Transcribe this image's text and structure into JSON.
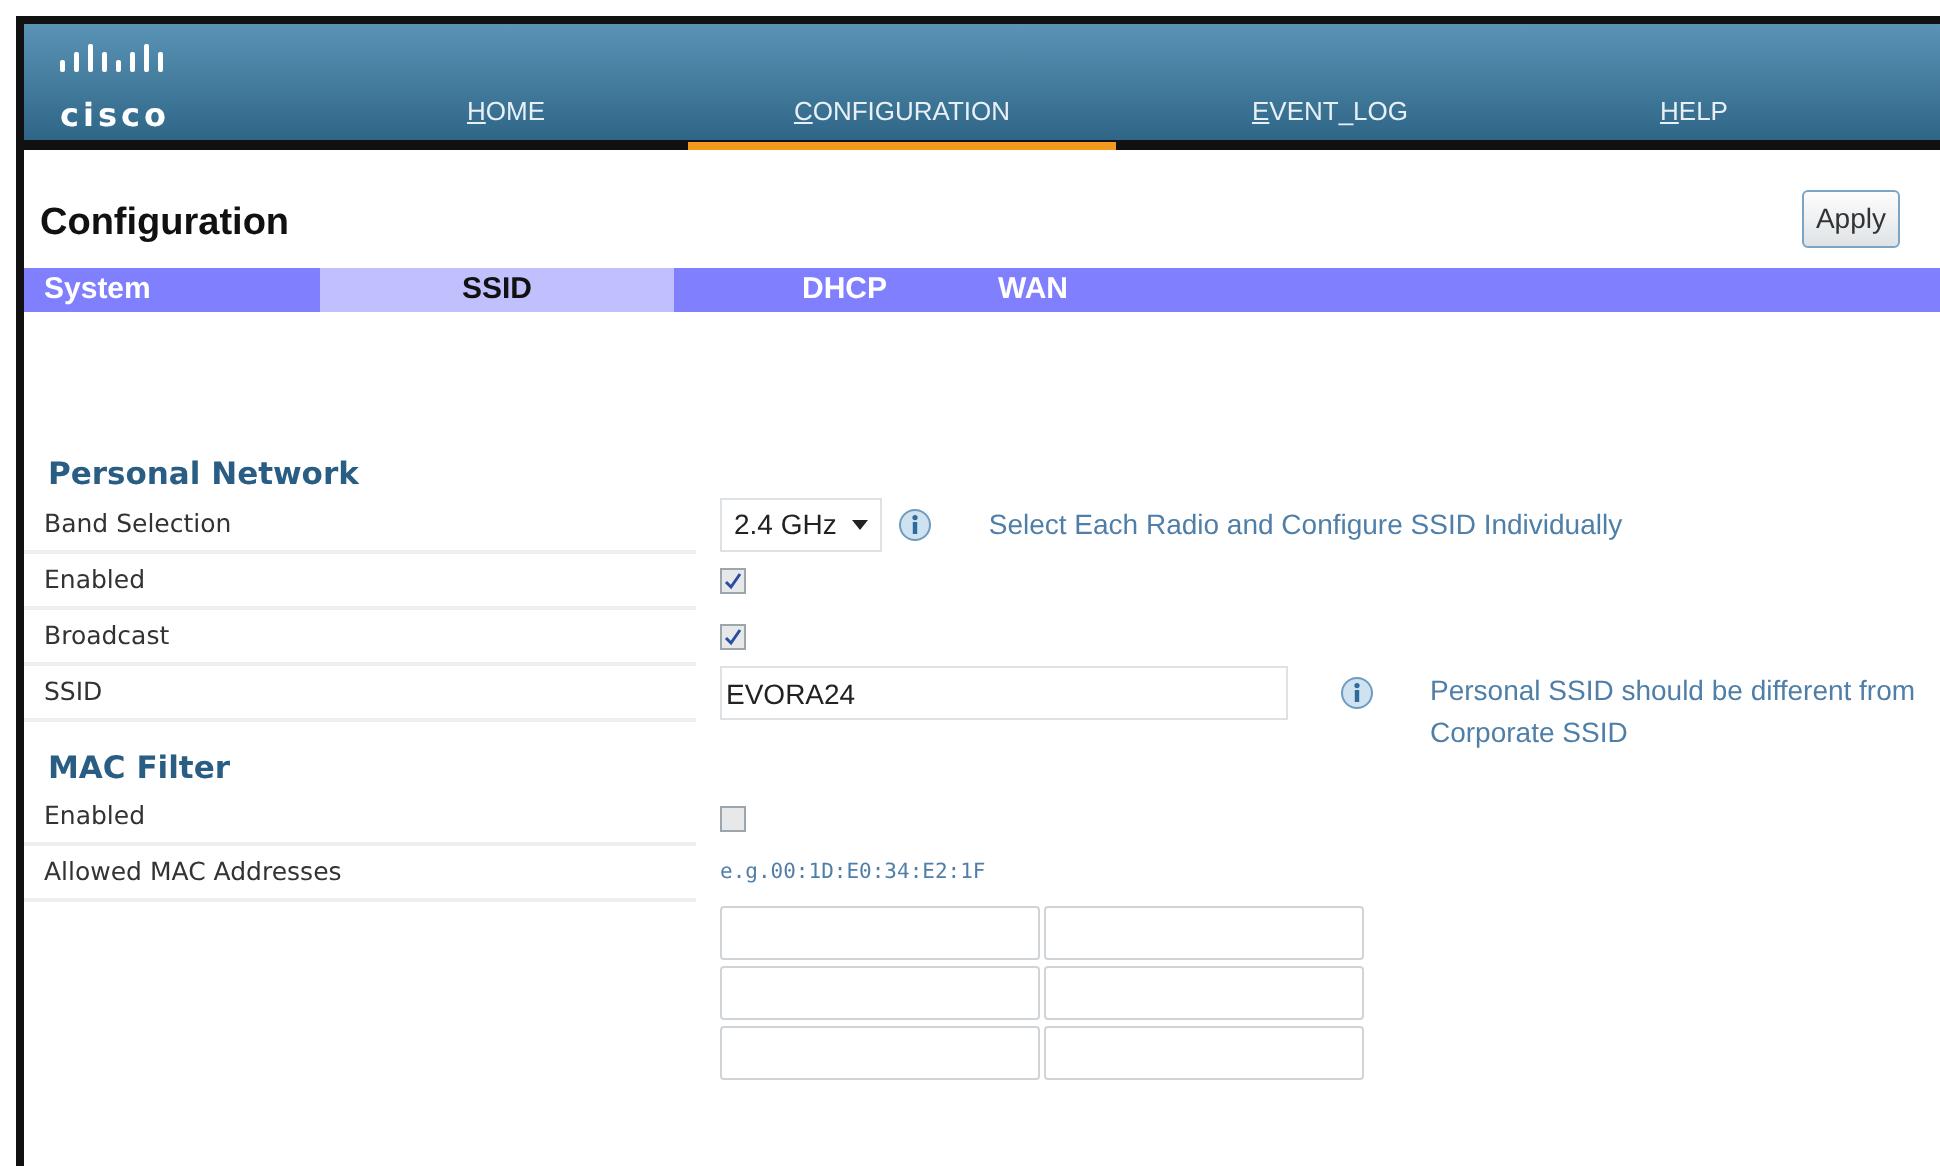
{
  "header": {
    "logo": "cisco"
  },
  "nav": [
    {
      "label": "HOME",
      "selected": false
    },
    {
      "label": "CONFIGURATION",
      "selected": true
    },
    {
      "label": "EVENT_LOG",
      "selected": false
    },
    {
      "label": "HELP",
      "selected": false
    }
  ],
  "page_title": "Configuration",
  "apply_button": "Apply",
  "tabs": [
    {
      "label": "System",
      "selected": false
    },
    {
      "label": "SSID",
      "selected": true
    },
    {
      "label": "DHCP",
      "selected": false
    },
    {
      "label": "WAN",
      "selected": false
    }
  ],
  "sections": [
    {
      "title": "Personal Network",
      "rows": [
        {
          "kind": "select",
          "label": "Band Selection",
          "value": "2.4 GHz",
          "hint": "Select Each Radio and Configure SSID Individually"
        },
        {
          "kind": "checkbox",
          "label": "Enabled",
          "checked": true
        },
        {
          "kind": "checkbox",
          "label": "Broadcast",
          "checked": true
        },
        {
          "kind": "text",
          "label": "SSID",
          "value": "EVORA24",
          "hint": "Personal SSID should be different from Corporate SSID"
        }
      ]
    },
    {
      "title": "MAC Filter",
      "rows": [
        {
          "kind": "checkbox",
          "label": "Enabled",
          "checked": false
        },
        {
          "kind": "example",
          "label": "Allowed MAC Addresses",
          "example": "e.g.00:1D:E0:34:E2:1F"
        }
      ],
      "address_fields": [
        [
          {
            "kind": "input"
          },
          {
            "kind": "input"
          }
        ],
        [
          {
            "kind": "input"
          },
          {
            "kind": "input"
          }
        ],
        [
          {
            "kind": "input"
          },
          {
            "kind": "input"
          }
        ]
      ]
    }
  ]
}
